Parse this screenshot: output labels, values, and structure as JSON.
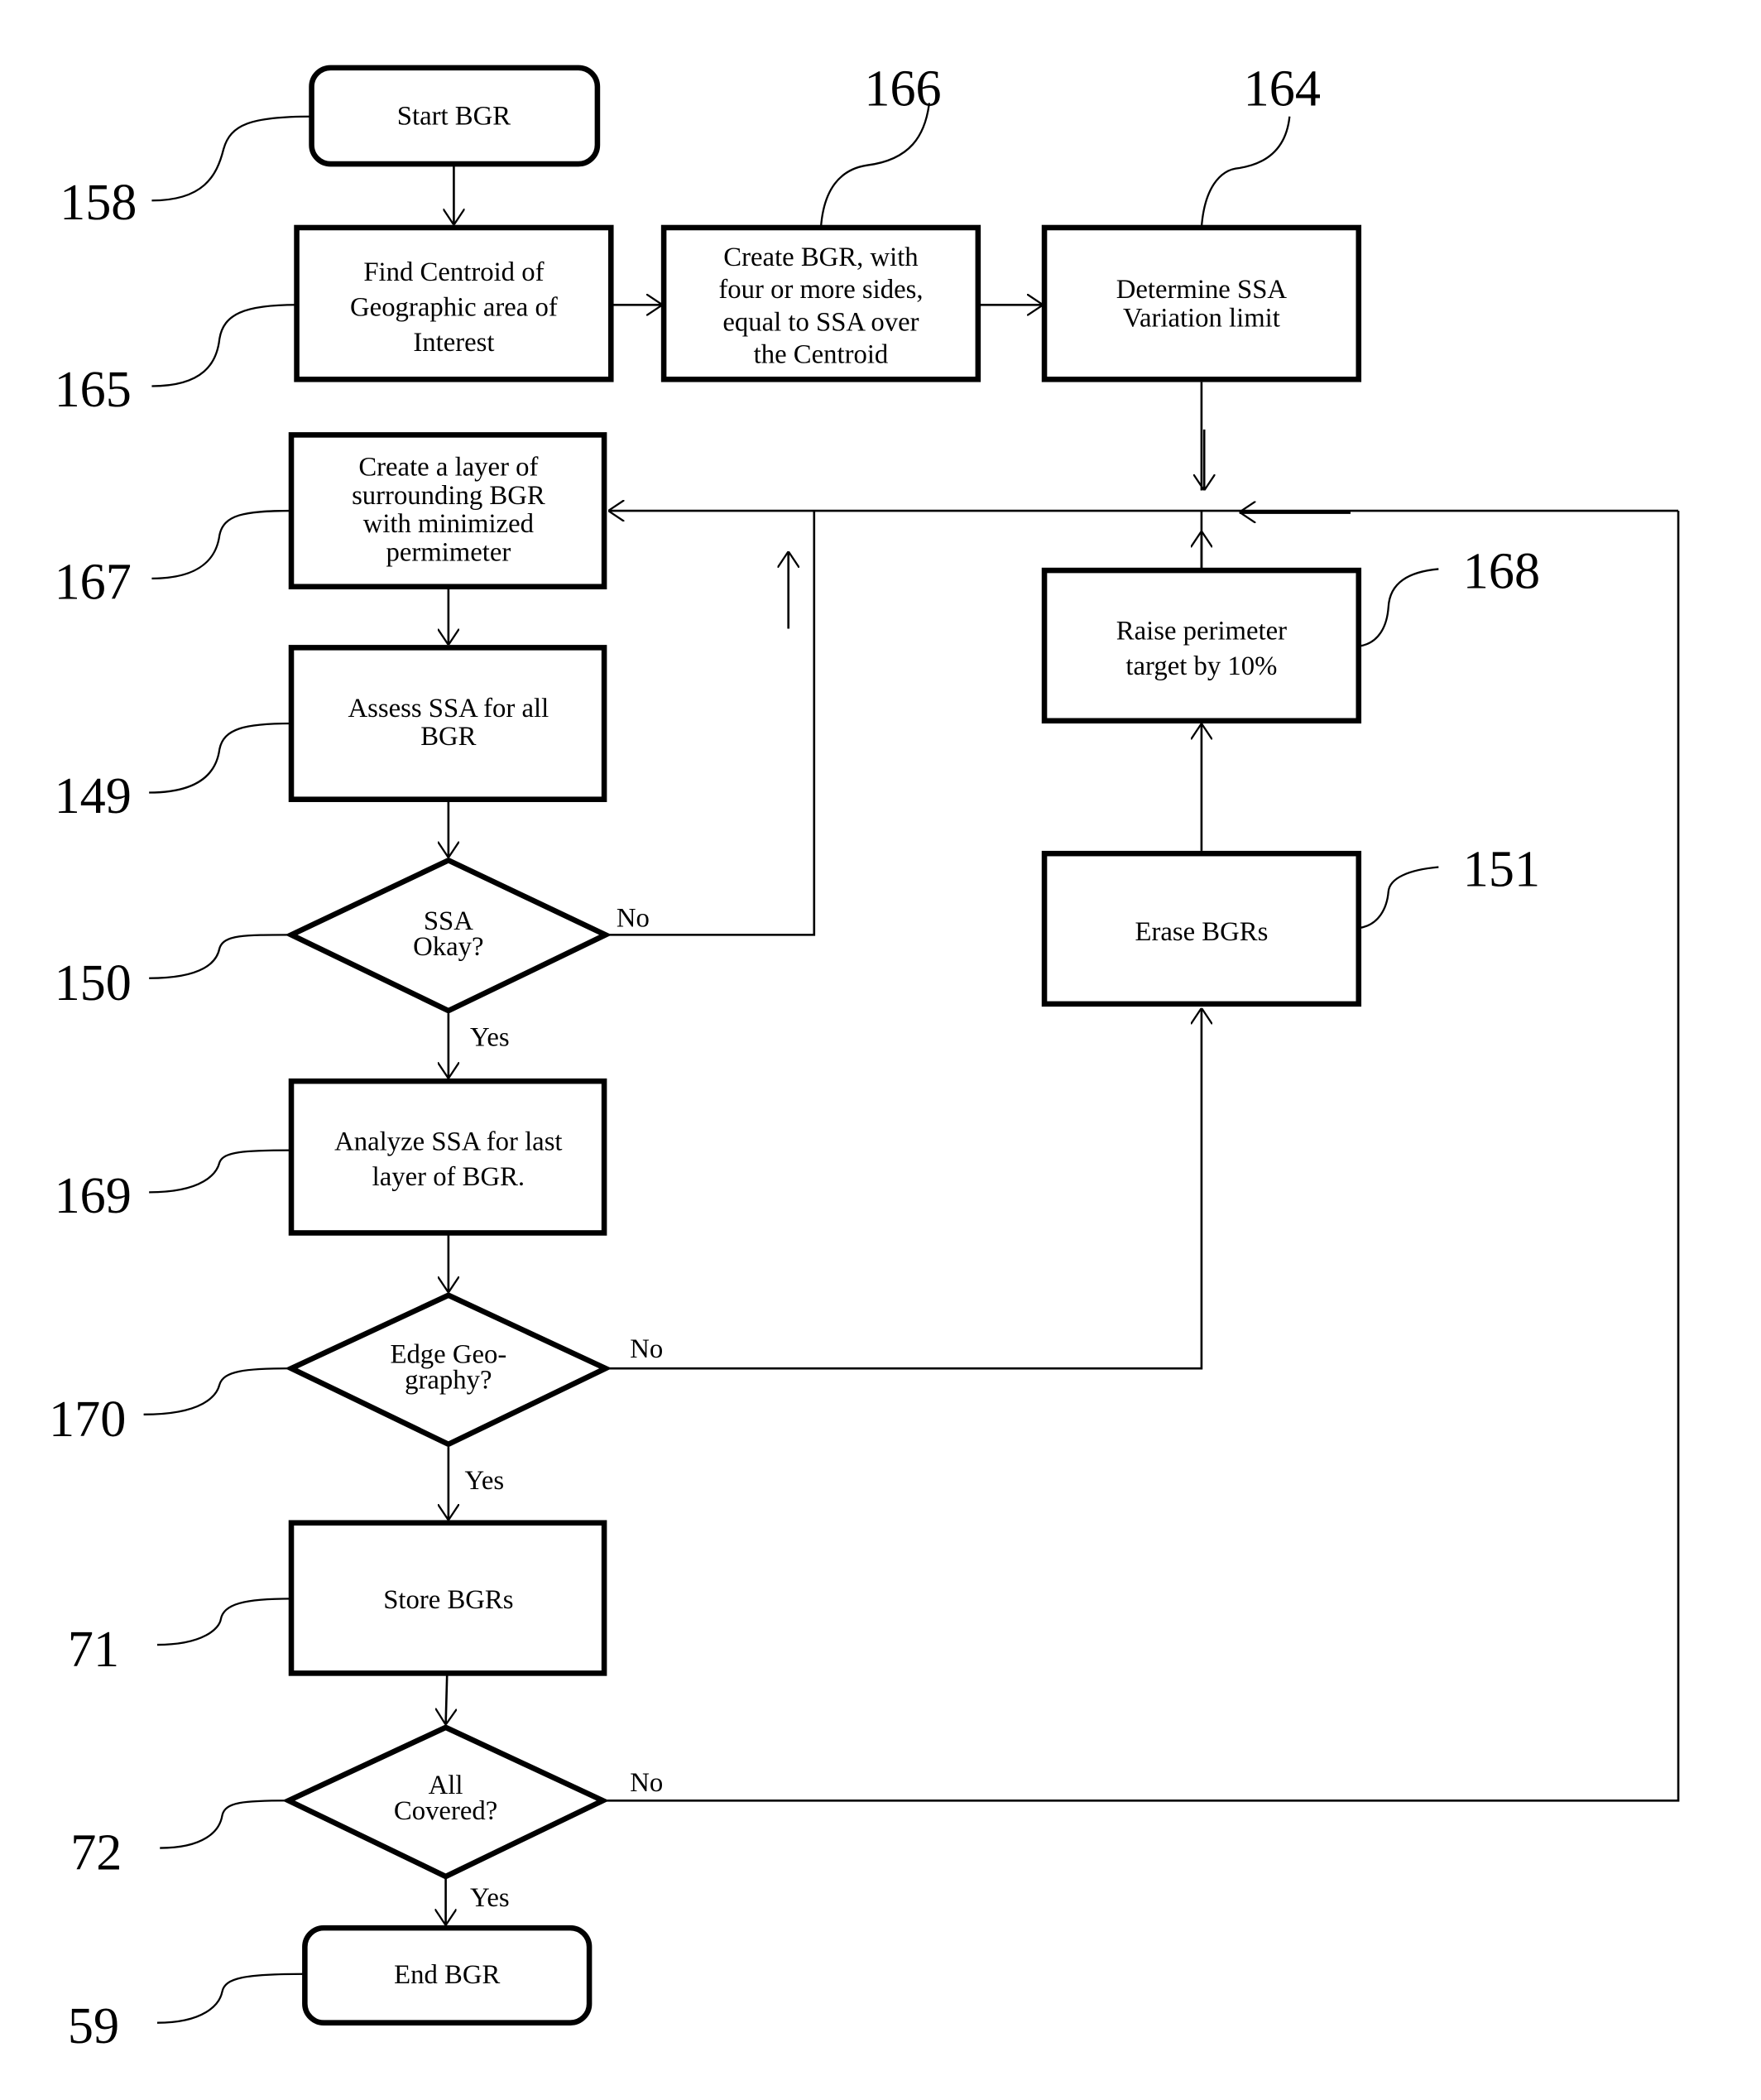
{
  "diagram": {
    "type": "flowchart",
    "colors": {
      "stroke": "#000000",
      "background": "#ffffff"
    },
    "nodes": [
      {
        "id": "start",
        "shape": "terminal",
        "ref": "158",
        "lines": [
          "Start BGR"
        ]
      },
      {
        "id": "find_centroid",
        "shape": "process",
        "ref": "165",
        "lines": [
          "Find Centroid of",
          "Geographic area of",
          "Interest"
        ]
      },
      {
        "id": "create_bgr",
        "shape": "process",
        "ref": "166",
        "lines": [
          "Create BGR, with",
          "four or more sides,",
          "equal to SSA over",
          "the Centroid"
        ]
      },
      {
        "id": "determine_ssa",
        "shape": "process",
        "ref": "164",
        "lines": [
          "Determine SSA",
          "Variation limit"
        ]
      },
      {
        "id": "create_layer",
        "shape": "process",
        "ref": "167",
        "lines": [
          "Create a layer of",
          "surrounding BGR",
          "with minimized",
          "permimeter"
        ]
      },
      {
        "id": "assess_ssa",
        "shape": "process",
        "ref": "149",
        "lines": [
          "Assess SSA for all",
          "BGR"
        ]
      },
      {
        "id": "ssa_okay",
        "shape": "decision",
        "ref": "150",
        "lines": [
          "SSA",
          "Okay?"
        ]
      },
      {
        "id": "analyze_ssa",
        "shape": "process",
        "ref": "169",
        "lines": [
          "Analyze SSA for last",
          "layer of BGR."
        ]
      },
      {
        "id": "edge_geo",
        "shape": "decision",
        "ref": "170",
        "lines": [
          "Edge Geo-",
          "graphy?"
        ]
      },
      {
        "id": "store_bgrs",
        "shape": "process",
        "ref": "71",
        "lines": [
          "Store BGRs"
        ]
      },
      {
        "id": "all_covered",
        "shape": "decision",
        "ref": "72",
        "lines": [
          "All",
          "Covered?"
        ]
      },
      {
        "id": "end",
        "shape": "terminal",
        "ref": "59",
        "lines": [
          "End BGR"
        ]
      },
      {
        "id": "raise_perimeter",
        "shape": "process",
        "ref": "168",
        "lines": [
          "Raise perimeter",
          "target by 10%"
        ]
      },
      {
        "id": "erase_bgrs",
        "shape": "process",
        "ref": "151",
        "lines": [
          "Erase BGRs"
        ]
      }
    ],
    "edges": [
      {
        "from": "start",
        "to": "find_centroid",
        "label": ""
      },
      {
        "from": "find_centroid",
        "to": "create_bgr",
        "label": ""
      },
      {
        "from": "create_bgr",
        "to": "determine_ssa",
        "label": ""
      },
      {
        "from": "determine_ssa",
        "to": "create_layer",
        "label": ""
      },
      {
        "from": "create_layer",
        "to": "assess_ssa",
        "label": ""
      },
      {
        "from": "assess_ssa",
        "to": "ssa_okay",
        "label": ""
      },
      {
        "from": "ssa_okay",
        "to": "create_layer",
        "label": "No"
      },
      {
        "from": "ssa_okay",
        "to": "analyze_ssa",
        "label": "Yes"
      },
      {
        "from": "analyze_ssa",
        "to": "edge_geo",
        "label": ""
      },
      {
        "from": "edge_geo",
        "to": "erase_bgrs",
        "label": "No"
      },
      {
        "from": "edge_geo",
        "to": "store_bgrs",
        "label": "Yes"
      },
      {
        "from": "erase_bgrs",
        "to": "raise_perimeter",
        "label": ""
      },
      {
        "from": "raise_perimeter",
        "to": "create_layer",
        "label": ""
      },
      {
        "from": "store_bgrs",
        "to": "all_covered",
        "label": ""
      },
      {
        "from": "all_covered",
        "to": "create_layer",
        "label": "No"
      },
      {
        "from": "all_covered",
        "to": "end",
        "label": "Yes"
      }
    ],
    "edge_labels": {
      "ssa_no": "No",
      "ssa_yes": "Yes",
      "edge_no": "No",
      "edge_yes": "Yes",
      "covered_no": "No",
      "covered_yes": "Yes"
    }
  }
}
